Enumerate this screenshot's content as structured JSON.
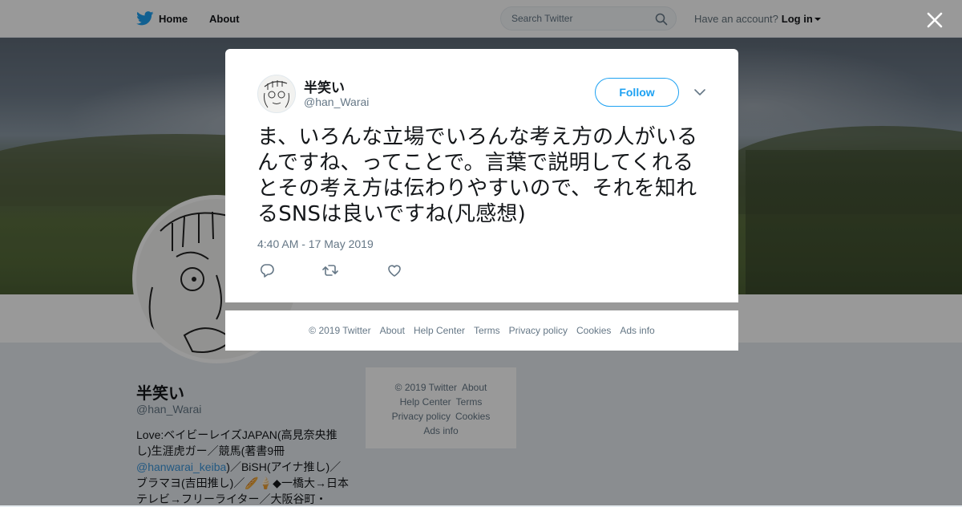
{
  "topbar": {
    "home_label": "Home",
    "about_label": "About",
    "search_placeholder": "Search Twitter",
    "account_prompt": "Have an account?",
    "login_label": "Log in"
  },
  "profile": {
    "name": "半笑い",
    "handle": "@han_Warai",
    "bio_part1": "Love:ベイビーレイズJAPAN(高見奈央推し)生涯虎ガー／競馬(著書9冊 ",
    "bio_mention": "@hanwarai_keiba",
    "bio_part2": ")／BiSH(アイナ推し)／ブラマヨ(吉田推し)／🥖🍦◆一橋大→日本テレビ→フリーライター／大阪谷町・"
  },
  "sidebar_footer": {
    "copyright": "© 2019 Twitter",
    "about": "About",
    "help": "Help Center",
    "terms": "Terms",
    "privacy": "Privacy policy",
    "cookies": "Cookies",
    "ads": "Ads info"
  },
  "tweet": {
    "author_name": "半笑い",
    "author_handle": "@han_Warai",
    "follow_label": "Follow",
    "text": "ま、いろんな立場でいろんな考え方の人がいるんですね、ってことで。言葉で説明してくれるとその考え方は伝わりやすいので、それを知れるSNSは良いですね(凡感想)",
    "timestamp": "4:40 AM - 17 May 2019"
  },
  "modal_footer": {
    "copyright": "© 2019 Twitter",
    "about": "About",
    "help": "Help Center",
    "terms": "Terms",
    "privacy": "Privacy policy",
    "cookies": "Cookies",
    "ads": "Ads info"
  },
  "colors": {
    "accent": "#1da1f2",
    "text": "#14171a",
    "muted": "#657786",
    "overlay": "rgba(0,0,0,0.4)"
  },
  "icons": [
    "twitter-bird-icon",
    "search-icon",
    "caret-down-icon",
    "close-icon",
    "chevron-down-icon",
    "reply-icon",
    "retweet-icon",
    "like-icon"
  ]
}
